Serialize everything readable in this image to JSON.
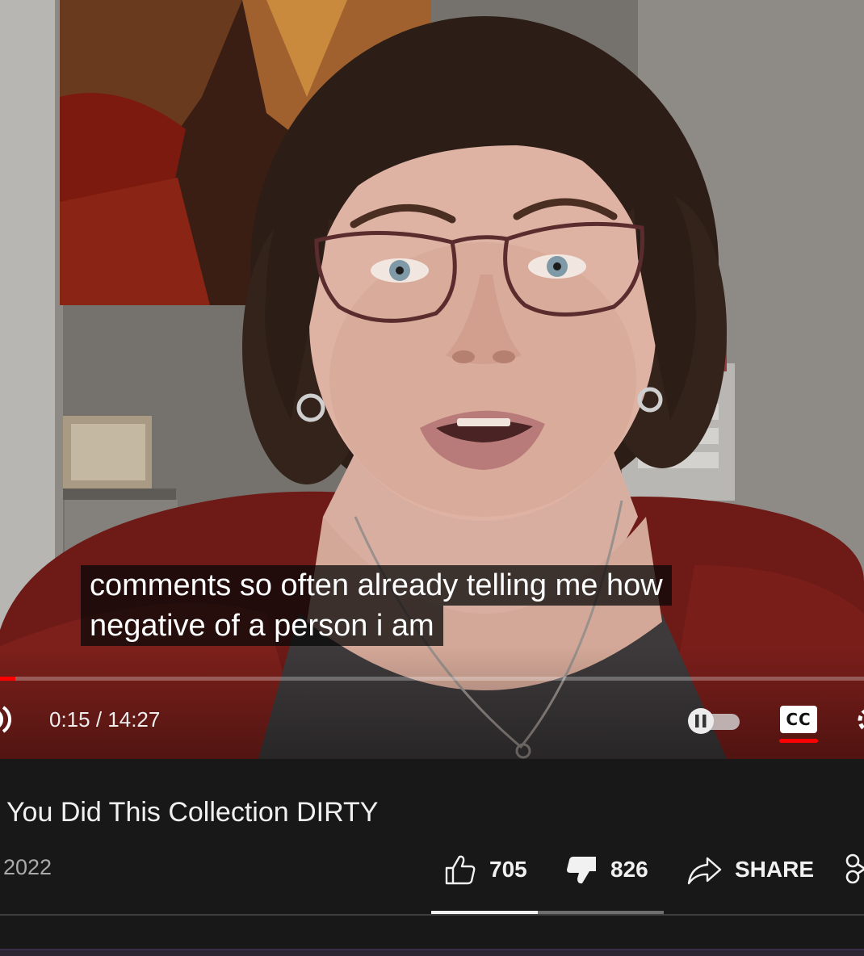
{
  "player": {
    "caption_lines": [
      "comments so often already telling me how",
      "negative of a person i am"
    ],
    "time_current": "0:15",
    "time_separator": " / ",
    "time_total": "14:27",
    "progress_fraction": 0.0173,
    "cc_label": "CC",
    "icons": {
      "volume": "volume-icon",
      "autoplay": "autoplay-toggle-icon",
      "captions": "cc-icon",
      "settings": "settings-gear-icon"
    },
    "accent_color": "#ff0000"
  },
  "video": {
    "title": "You Did This Collection DIRTY",
    "date": "2022"
  },
  "actions": {
    "like_count": "705",
    "dislike_count": "826",
    "share_label": "SHARE",
    "like_fraction": 0.46,
    "icons": {
      "like": "thumbs-up-icon",
      "dislike": "thumbs-down-icon",
      "share": "share-arrow-icon",
      "clip": "scissors-clip-icon"
    }
  }
}
